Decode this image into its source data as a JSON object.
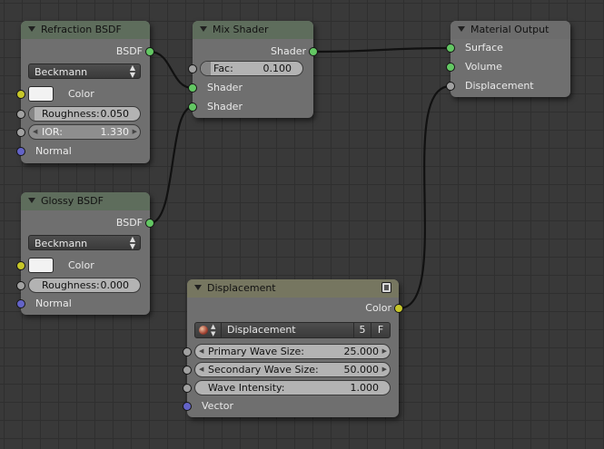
{
  "nodes": {
    "refraction": {
      "title": "Refraction BSDF",
      "output": "BSDF",
      "distribution": "Beckmann",
      "color_label": "Color",
      "roughness_label": "Roughness:",
      "roughness_value": "0.050",
      "roughness_fraction": 0.05,
      "ior_label": "IOR:",
      "ior_value": "1.330",
      "normal_label": "Normal"
    },
    "glossy": {
      "title": "Glossy BSDF",
      "output": "BSDF",
      "distribution": "Beckmann",
      "color_label": "Color",
      "roughness_label": "Roughness:",
      "roughness_value": "0.000",
      "roughness_fraction": 0.0,
      "normal_label": "Normal"
    },
    "mix": {
      "title": "Mix Shader",
      "output": "Shader",
      "fac_label": "Fac:",
      "fac_value": "0.100",
      "fac_fraction": 0.1,
      "shader1_label": "Shader",
      "shader2_label": "Shader"
    },
    "output": {
      "title": "Material Output",
      "surface_label": "Surface",
      "volume_label": "Volume",
      "displacement_label": "Displacement"
    },
    "displacement": {
      "title": "Displacement",
      "output": "Color",
      "texture_name": "Displacement",
      "users": "5",
      "fake_user": "F",
      "primary_label": "Primary Wave Size:",
      "primary_value": "25.000",
      "secondary_label": "Secondary Wave Size:",
      "secondary_value": "50.000",
      "intensity_label": "Wave Intensity:",
      "intensity_value": "1.000",
      "vector_label": "Vector"
    }
  },
  "colors": {
    "background": "#393939",
    "node_body": "#6f6f6f",
    "shader_socket": "#63c763",
    "float_socket": "#a1a1a1",
    "vector_socket": "#6363c7",
    "color_socket": "#c7c729",
    "link": "#111111"
  }
}
